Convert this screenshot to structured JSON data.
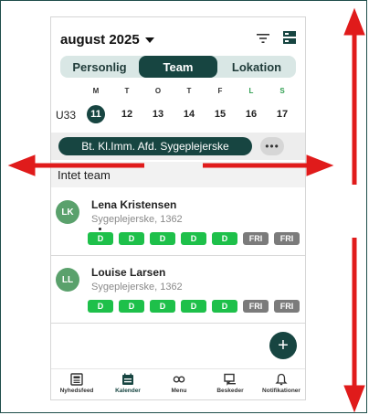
{
  "header": {
    "month": "august 2025"
  },
  "tabs": [
    {
      "label": "Personlig",
      "active": false
    },
    {
      "label": "Team",
      "active": true
    },
    {
      "label": "Lokation",
      "active": false
    }
  ],
  "week": {
    "days": [
      "M",
      "T",
      "O",
      "T",
      "F",
      "L",
      "S"
    ],
    "number": "U33",
    "dates": [
      "11",
      "12",
      "13",
      "14",
      "15",
      "16",
      "17"
    ]
  },
  "department": {
    "label": "Bt. Kl.Imm. Afd. Sygeplejerske",
    "more": "•••"
  },
  "section": {
    "title": "Intet team"
  },
  "people": [
    {
      "initials": "LK",
      "name": "Lena Kristensen",
      "role": "Sygeplejerske, 1362",
      "shifts": [
        "D",
        "D",
        "D",
        "D",
        "D",
        "FRI",
        "FRI"
      ]
    },
    {
      "initials": "LL",
      "name": "Louise Larsen",
      "role": "Sygeplejerske, 1362",
      "shifts": [
        "D",
        "D",
        "D",
        "D",
        "D",
        "FRI",
        "FRI"
      ]
    }
  ],
  "fab": {
    "label": "+"
  },
  "nav": [
    {
      "label": "Nyhedsfeed",
      "icon": "newsfeed-icon"
    },
    {
      "label": "Kalender",
      "icon": "calendar-icon",
      "active": true
    },
    {
      "label": "Menu",
      "icon": "infinity-icon"
    },
    {
      "label": "Beskeder",
      "icon": "chat-icon"
    },
    {
      "label": "Notifikationer",
      "icon": "bell-icon"
    }
  ],
  "colors": {
    "primary": "#174541",
    "shift_day": "#1ec04a",
    "shift_free": "#7b7b7b",
    "annotation": "#e01b1b",
    "avatar": "#5aa16c"
  }
}
